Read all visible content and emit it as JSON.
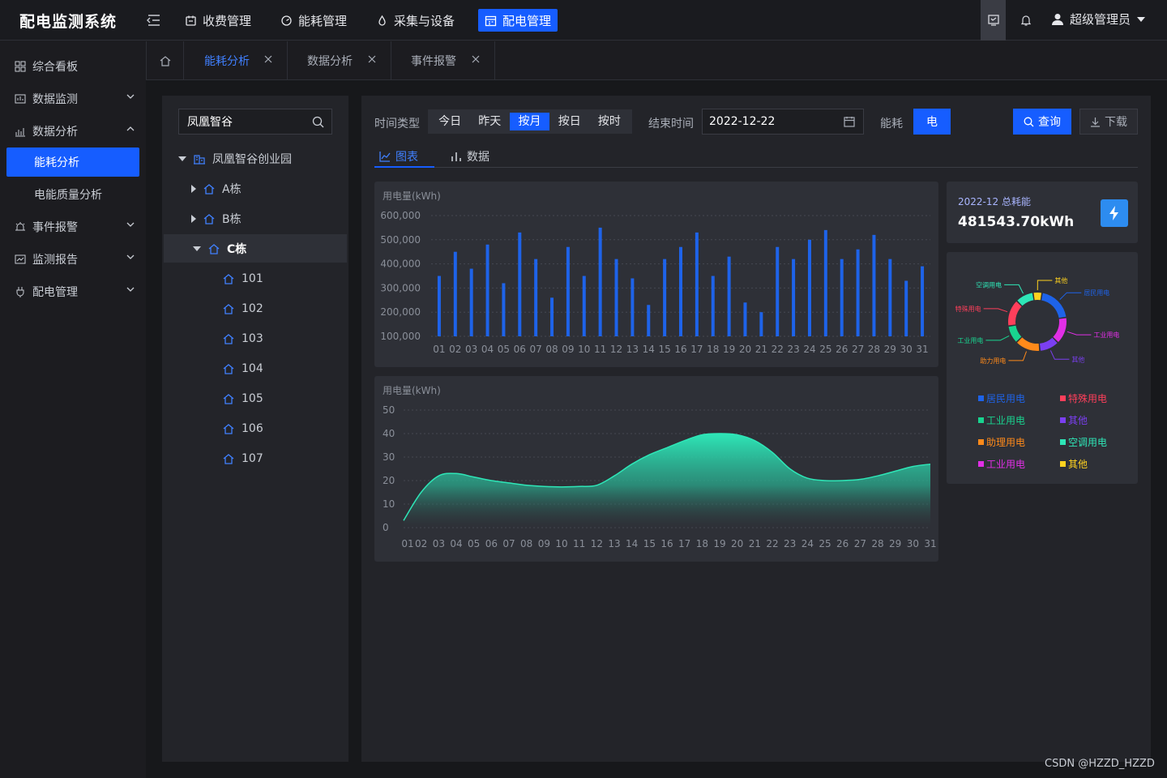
{
  "app": {
    "title": "配电监测系统"
  },
  "topnav": [
    {
      "label": "收费管理",
      "icon": "invoice-icon",
      "active": false
    },
    {
      "label": "能耗管理",
      "icon": "gauge-icon",
      "active": false
    },
    {
      "label": "采集与设备",
      "icon": "droplet-icon",
      "active": false
    },
    {
      "label": "配电管理",
      "icon": "calendar-grid-icon",
      "active": true
    }
  ],
  "user": {
    "name": "超级管理员"
  },
  "sidebar": {
    "items": [
      {
        "label": "综合看板",
        "icon": "dashboard-icon"
      },
      {
        "label": "数据监测",
        "icon": "monitor-icon"
      },
      {
        "label": "数据分析",
        "icon": "bar-analysis-icon",
        "expanded": true
      },
      {
        "label": "能耗分析",
        "sub": true,
        "active": true
      },
      {
        "label": "电能质量分析",
        "sub": true
      },
      {
        "label": "事件报警",
        "icon": "alarm-icon"
      },
      {
        "label": "监测报告",
        "icon": "report-icon"
      },
      {
        "label": "配电管理",
        "icon": "power-manage-icon"
      }
    ]
  },
  "tabs": [
    {
      "label": "能耗分析",
      "active": true
    },
    {
      "label": "数据分析",
      "active": false
    },
    {
      "label": "事件报警",
      "active": false
    }
  ],
  "tree": {
    "search_value": "凤凰智谷",
    "root": "凤凰智谷创业园",
    "buildings": [
      "A栋",
      "B栋",
      "C栋"
    ],
    "rooms": [
      "101",
      "102",
      "103",
      "104",
      "105",
      "106",
      "107"
    ]
  },
  "filters": {
    "time_type_label": "时间类型",
    "time_options": [
      "今日",
      "昨天",
      "按月",
      "按日",
      "按时"
    ],
    "time_selected": "按月",
    "end_time_label": "结束时间",
    "end_date": "2022-12-22",
    "energy_label": "能耗",
    "energy_value": "电",
    "query_label": "查询",
    "download_label": "下载"
  },
  "view_tabs": {
    "chart": "图表",
    "data": "数据",
    "active": "chart"
  },
  "stats": {
    "period": "2022-12 总耗能",
    "total": "481543.70kWh"
  },
  "colors": {
    "accent": "#165dff",
    "bar": "#1e63e9",
    "area": "#2ee6b7"
  },
  "chart_data": [
    {
      "type": "bar",
      "ylabel": "用电量(kWh)",
      "categories": [
        "01",
        "02",
        "03",
        "04",
        "05",
        "06",
        "07",
        "08",
        "09",
        "10",
        "11",
        "12",
        "13",
        "14",
        "15",
        "16",
        "17",
        "18",
        "19",
        "20",
        "21",
        "22",
        "23",
        "24",
        "25",
        "26",
        "27",
        "28",
        "29",
        "30",
        "31"
      ],
      "values": [
        350000,
        450000,
        380000,
        480000,
        320000,
        530000,
        420000,
        260000,
        470000,
        350000,
        550000,
        420000,
        340000,
        230000,
        420000,
        470000,
        530000,
        350000,
        430000,
        240000,
        200000,
        470000,
        420000,
        500000,
        540000,
        420000,
        460000,
        520000,
        420000,
        330000,
        390000
      ],
      "yticks": [
        "100,000",
        "200,000",
        "300,000",
        "400,000",
        "500,000",
        "600,000"
      ],
      "ylim": [
        100000,
        600000
      ],
      "grid": true
    },
    {
      "type": "area",
      "ylabel": "用电量(kWh)",
      "categories": [
        "01",
        "02",
        "03",
        "04",
        "05",
        "06",
        "07",
        "08",
        "09",
        "10",
        "11",
        "12",
        "13",
        "14",
        "15",
        "16",
        "17",
        "18",
        "19",
        "20",
        "21",
        "22",
        "23",
        "24",
        "25",
        "26",
        "27",
        "28",
        "29",
        "30",
        "31"
      ],
      "values": [
        3,
        15,
        22,
        23,
        21.5,
        20,
        19,
        18,
        17.5,
        17.3,
        17.5,
        18,
        22,
        27,
        31,
        34,
        37,
        39.5,
        40,
        39.5,
        37,
        32,
        25,
        21,
        20,
        20,
        20.5,
        22,
        24,
        26,
        27
      ],
      "yticks": [
        "0",
        "10",
        "20",
        "30",
        "40",
        "50"
      ],
      "ylim": [
        0,
        50
      ],
      "grid": true
    },
    {
      "type": "pie",
      "slices": [
        {
          "label": "其他",
          "value": 5,
          "color": "#ffd21f"
        },
        {
          "label": "居民用电",
          "value": 20,
          "color": "#1e63e9"
        },
        {
          "label": "工业用电",
          "value": 15,
          "color": "#e12fe6"
        },
        {
          "label": "其他",
          "value": 11,
          "color": "#7b3ff2"
        },
        {
          "label": "助力用电",
          "value": 14,
          "color": "#ff8a1a"
        },
        {
          "label": "工业用电",
          "value": 10,
          "color": "#19d38f"
        },
        {
          "label": "特殊用电",
          "value": 15,
          "color": "#ff3f5b"
        },
        {
          "label": "空调用电",
          "value": 10,
          "color": "#2ee6b7"
        }
      ],
      "callouts": [
        {
          "label": "其他",
          "color": "#ffd21f"
        },
        {
          "label": "居民用电",
          "color": "#1e63e9"
        },
        {
          "label": "工业用电",
          "color": "#e12fe6"
        },
        {
          "label": "其他",
          "color": "#7b3ff2"
        },
        {
          "label": "助力用电",
          "color": "#ff8a1a"
        },
        {
          "label": "工业用电",
          "color": "#19d38f"
        },
        {
          "label": "特殊用电",
          "color": "#ff3f5b"
        },
        {
          "label": "空调用电",
          "color": "#2ee6b7"
        }
      ],
      "legend": [
        {
          "label": "居民用电",
          "color": "#1e63e9"
        },
        {
          "label": "特殊用电",
          "color": "#ff3f5b"
        },
        {
          "label": "工业用电",
          "color": "#19d38f"
        },
        {
          "label": "其他",
          "color": "#7b3ff2"
        },
        {
          "label": "助理用电",
          "color": "#ff8a1a"
        },
        {
          "label": "空调用电",
          "color": "#2ee6b7"
        },
        {
          "label": "工业用电",
          "color": "#e12fe6"
        },
        {
          "label": "其他",
          "color": "#ffd21f"
        }
      ]
    }
  ],
  "watermark": "CSDN @HZZD_HZZD"
}
